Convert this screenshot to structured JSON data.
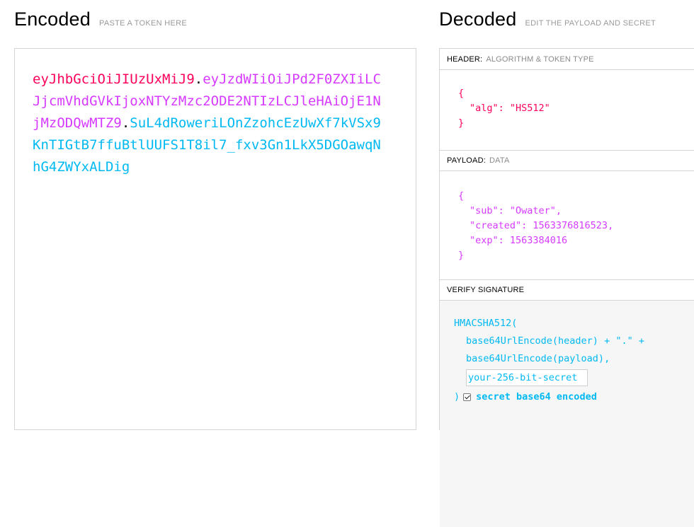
{
  "encoded": {
    "title": "Encoded",
    "subtitle": "PASTE A TOKEN HERE",
    "token_header": "eyJhbGciOiJIUzUxMiJ9",
    "token_payload": "eyJzdWIiOiJPd2F0ZXIiLCJjcmVhdGVkIjoxNTYzMzc2ODE2NTIzLCJleHAiOjE1NjMzODQwMTZ9",
    "token_signature": "SuL4dRoweriLOnZzohcEzUwXf7kVSx9KnTIGtB7ffuBtlUUFS1T8il7_fxv3Gn1LkX5DGOawqNhG4ZWYxALDig",
    "dot": "."
  },
  "decoded": {
    "title": "Decoded",
    "subtitle": "EDIT THE PAYLOAD AND SECRET",
    "header_section": {
      "label": "HEADER:",
      "sublabel": "ALGORITHM & TOKEN TYPE",
      "open_brace": "{",
      "close_brace": "}",
      "line1": "\"alg\": \"HS512\""
    },
    "payload_section": {
      "label": "PAYLOAD:",
      "sublabel": "DATA",
      "open_brace": "{",
      "close_brace": "}",
      "line1": "\"sub\": \"Owater\",",
      "line2": "\"created\": 1563376816523,",
      "line3": "\"exp\": 1563384016"
    },
    "verify_section": {
      "label": "VERIFY SIGNATURE",
      "func_open": "HMACSHA512(",
      "line1": "base64UrlEncode(header) + \".\" +",
      "line2": "base64UrlEncode(payload),",
      "secret_value": "your-256-bit-secret",
      "close": ")",
      "checkbox_checked": true,
      "checkbox_label": "secret base64 encoded"
    }
  },
  "colors": {
    "header": "#fb015b",
    "payload": "#d63aff",
    "signature": "#00b9f1"
  }
}
